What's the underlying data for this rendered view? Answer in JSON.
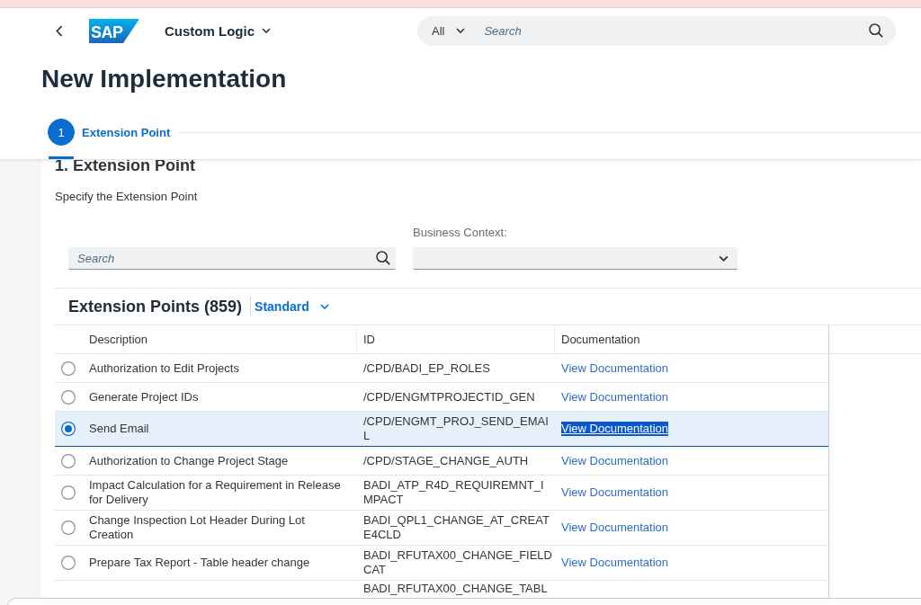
{
  "shell_bar": {
    "logo_text": "SAP",
    "app_title": "Custom Logic",
    "search": {
      "scope": "All",
      "placeholder": "Search"
    }
  },
  "page_title": "New Implementation",
  "wizard": {
    "steps": [
      {
        "number": "1",
        "label": "Extension Point",
        "selected": true
      }
    ]
  },
  "step": {
    "heading": "1. Extension Point",
    "instruction": "Specify the Extension Point",
    "search": {
      "placeholder": "Search"
    },
    "business_context": {
      "label": "Business Context:"
    }
  },
  "table": {
    "title": "Extension Points (859)",
    "variant": "Standard",
    "columns": [
      "Description",
      "ID",
      "Documentation"
    ],
    "rows": [
      {
        "selected": false,
        "description": "Authorization to Edit Projects",
        "id": "/CPD/BADI_EP_ROLES",
        "documentation": {
          "text": "View Documentation",
          "highlighted": false
        }
      },
      {
        "selected": false,
        "description": "Generate Project IDs",
        "id": "/CPD/ENGMTPROJECTID_GEN",
        "documentation": {
          "text": "View Documentation",
          "highlighted": false
        }
      },
      {
        "selected": true,
        "description": "Send Email",
        "id": "/CPD/ENGMT_PROJ_SEND_EMAIL",
        "documentation": {
          "text": "View Documentation",
          "highlighted": true
        }
      },
      {
        "selected": false,
        "description": "Authorization to Change Project Stage",
        "id": "/CPD/STAGE_CHANGE_AUTH",
        "documentation": {
          "text": "View Documentation",
          "highlighted": false
        }
      },
      {
        "selected": false,
        "description": "Impact Calculation for a Requirement in Release for Delivery",
        "id": "BADI_ATP_R4D_REQUIREMNT_IMPACT",
        "documentation": {
          "text": "View Documentation",
          "highlighted": false
        }
      },
      {
        "selected": false,
        "description": "Change Inspection Lot Header During Lot Creation",
        "id": "BADI_QPL1_CHANGE_AT_CREATE4CLD",
        "documentation": {
          "text": "View Documentation",
          "highlighted": false
        }
      },
      {
        "selected": false,
        "description": "Prepare Tax Report - Table header change",
        "id": "BADI_RFUTAX00_CHANGE_FIELDCAT",
        "documentation": {
          "text": "View Documentation",
          "highlighted": false
        }
      },
      {
        "id": "BADI_RFUTAX00_CHANGE_TABL"
      }
    ]
  }
}
